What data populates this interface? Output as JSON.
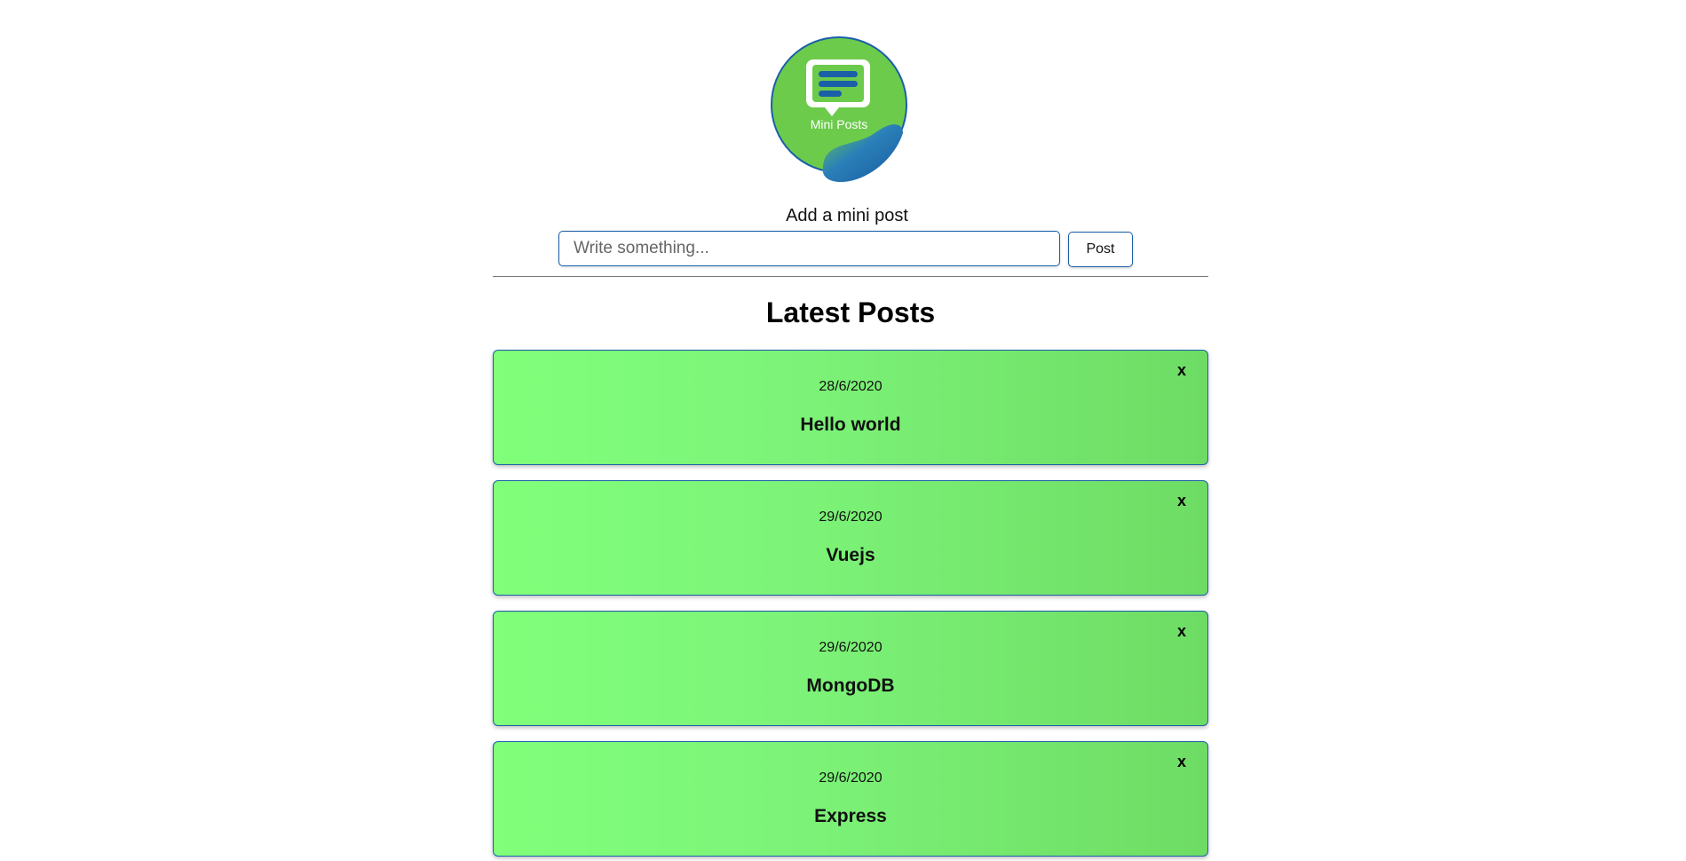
{
  "logo": {
    "text": "Mini Posts",
    "icon": "chat-bubble-icon",
    "colors": {
      "green": "#6dcb4c",
      "blue": "#1a5fa8"
    }
  },
  "form": {
    "label": "Add a mini post",
    "input_placeholder": "Write something...",
    "input_value": "",
    "button_label": "Post"
  },
  "section": {
    "title": "Latest Posts"
  },
  "posts": [
    {
      "date": "28/6/2020",
      "text": "Hello world",
      "delete_label": "x"
    },
    {
      "date": "29/6/2020",
      "text": "Vuejs",
      "delete_label": "x"
    },
    {
      "date": "29/6/2020",
      "text": "MongoDB",
      "delete_label": "x"
    },
    {
      "date": "29/6/2020",
      "text": "Express",
      "delete_label": "x"
    }
  ],
  "colors": {
    "accent": "#1a5fa8",
    "card_gradient_start": "#80ff7a",
    "card_gradient_end": "#6edc64"
  }
}
